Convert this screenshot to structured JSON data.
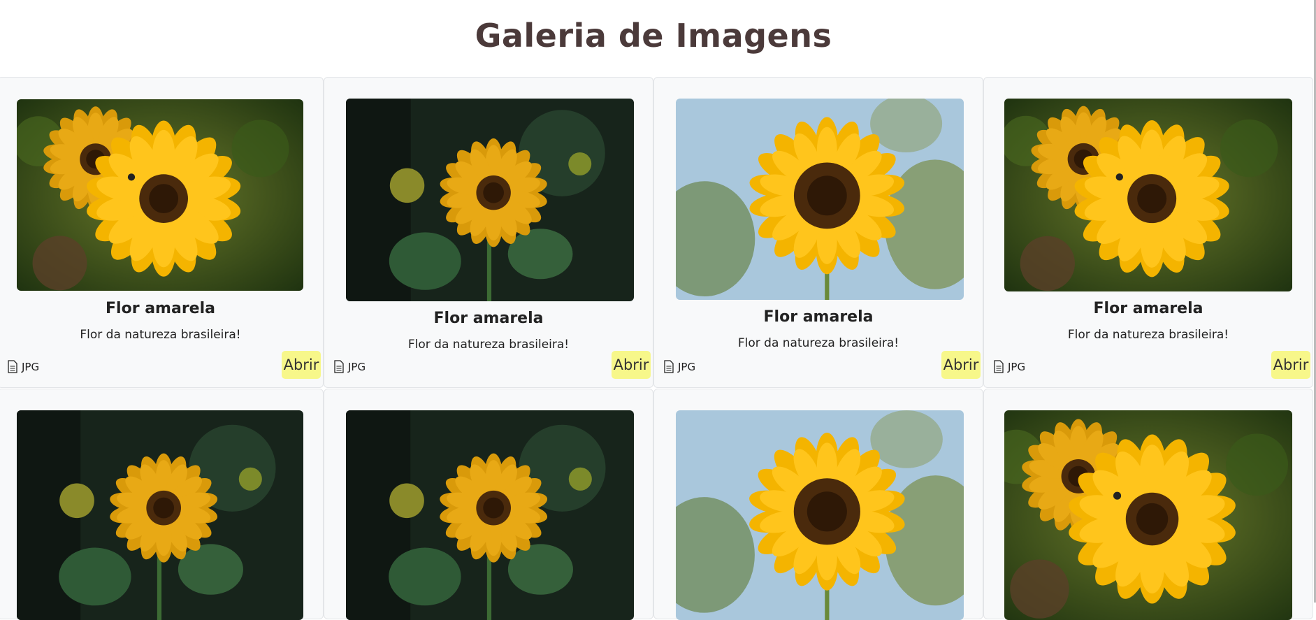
{
  "page": {
    "title": "Galeria de Imagens"
  },
  "gallery": {
    "items": [
      {
        "image": "sunflower-bee",
        "title": "Flor amarela",
        "description": "Flor da natureza brasileira!",
        "type": "JPG",
        "button": "Abrir"
      },
      {
        "image": "sunflower-dark",
        "title": "Flor amarela",
        "description": "Flor da natureza brasileira!",
        "type": "JPG",
        "button": "Abrir"
      },
      {
        "image": "sunflower-sky",
        "title": "Flor amarela",
        "description": "Flor da natureza brasileira!",
        "type": "JPG",
        "button": "Abrir"
      },
      {
        "image": "sunflower-bee",
        "title": "Flor amarela",
        "description": "Flor da natureza brasileira!",
        "type": "JPG",
        "button": "Abrir"
      },
      {
        "image": "sunflower-dark"
      },
      {
        "image": "sunflower-dark"
      },
      {
        "image": "sunflower-sky"
      },
      {
        "image": "sunflower-bee"
      }
    ]
  }
}
